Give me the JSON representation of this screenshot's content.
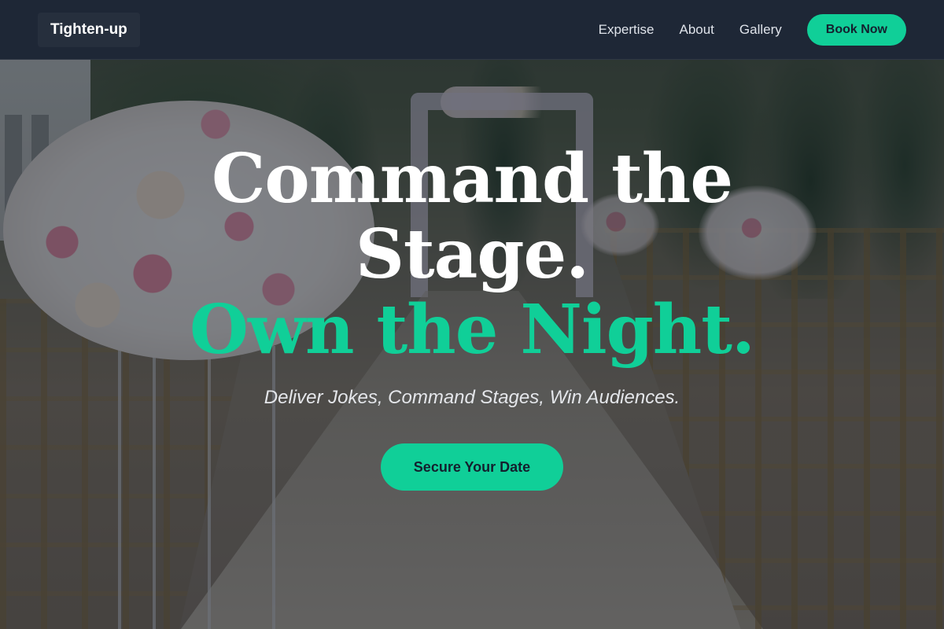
{
  "nav": {
    "brand": "Tighten-up",
    "links": [
      {
        "label": "Expertise"
      },
      {
        "label": "About"
      },
      {
        "label": "Gallery"
      }
    ],
    "cta_label": "Book Now"
  },
  "hero": {
    "headline_line1": "Command the",
    "headline_line2": "Stage.",
    "headline_accent": "Own the Night.",
    "tagline": "Deliver Jokes, Command Stages, Win Audiences.",
    "cta_label": "Secure Your Date"
  },
  "colors": {
    "accent": "#10cf98",
    "navbar_bg": "#1e2736",
    "text_light": "#ffffff",
    "button_text": "#14202e"
  }
}
